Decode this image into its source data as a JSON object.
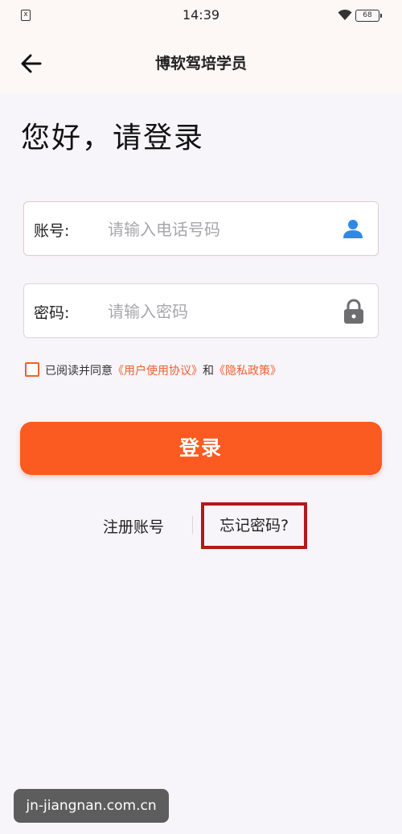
{
  "status_bar": {
    "sim_icon": "x",
    "time": "14:39",
    "wifi_icon": "wifi-icon",
    "battery": "68"
  },
  "app_bar": {
    "back_icon": "arrow-left-icon",
    "title": "博软驾培学员"
  },
  "greeting": "您好，请登录",
  "account_field": {
    "label": "账号:",
    "placeholder": "请输入电话号码",
    "value": "",
    "icon": "user-icon",
    "icon_color": "#2e8ae6"
  },
  "password_field": {
    "label": "密码:",
    "placeholder": "请输入密码",
    "value": "",
    "icon": "lock-icon",
    "icon_color": "#6e6e70"
  },
  "agreement": {
    "checked": false,
    "prefix": "已阅读并同意",
    "terms_link": "《用户使用协议》",
    "and": "和",
    "privacy_link": "《隐私政策》"
  },
  "login_button": "登录",
  "register_link": "注册账号",
  "forgot_link": "忘记密码?",
  "watermark": "jn-jiangnan.com.cn",
  "colors": {
    "accent": "#fb5a21",
    "link": "#f06030",
    "highlight_box": "#b3191b"
  }
}
